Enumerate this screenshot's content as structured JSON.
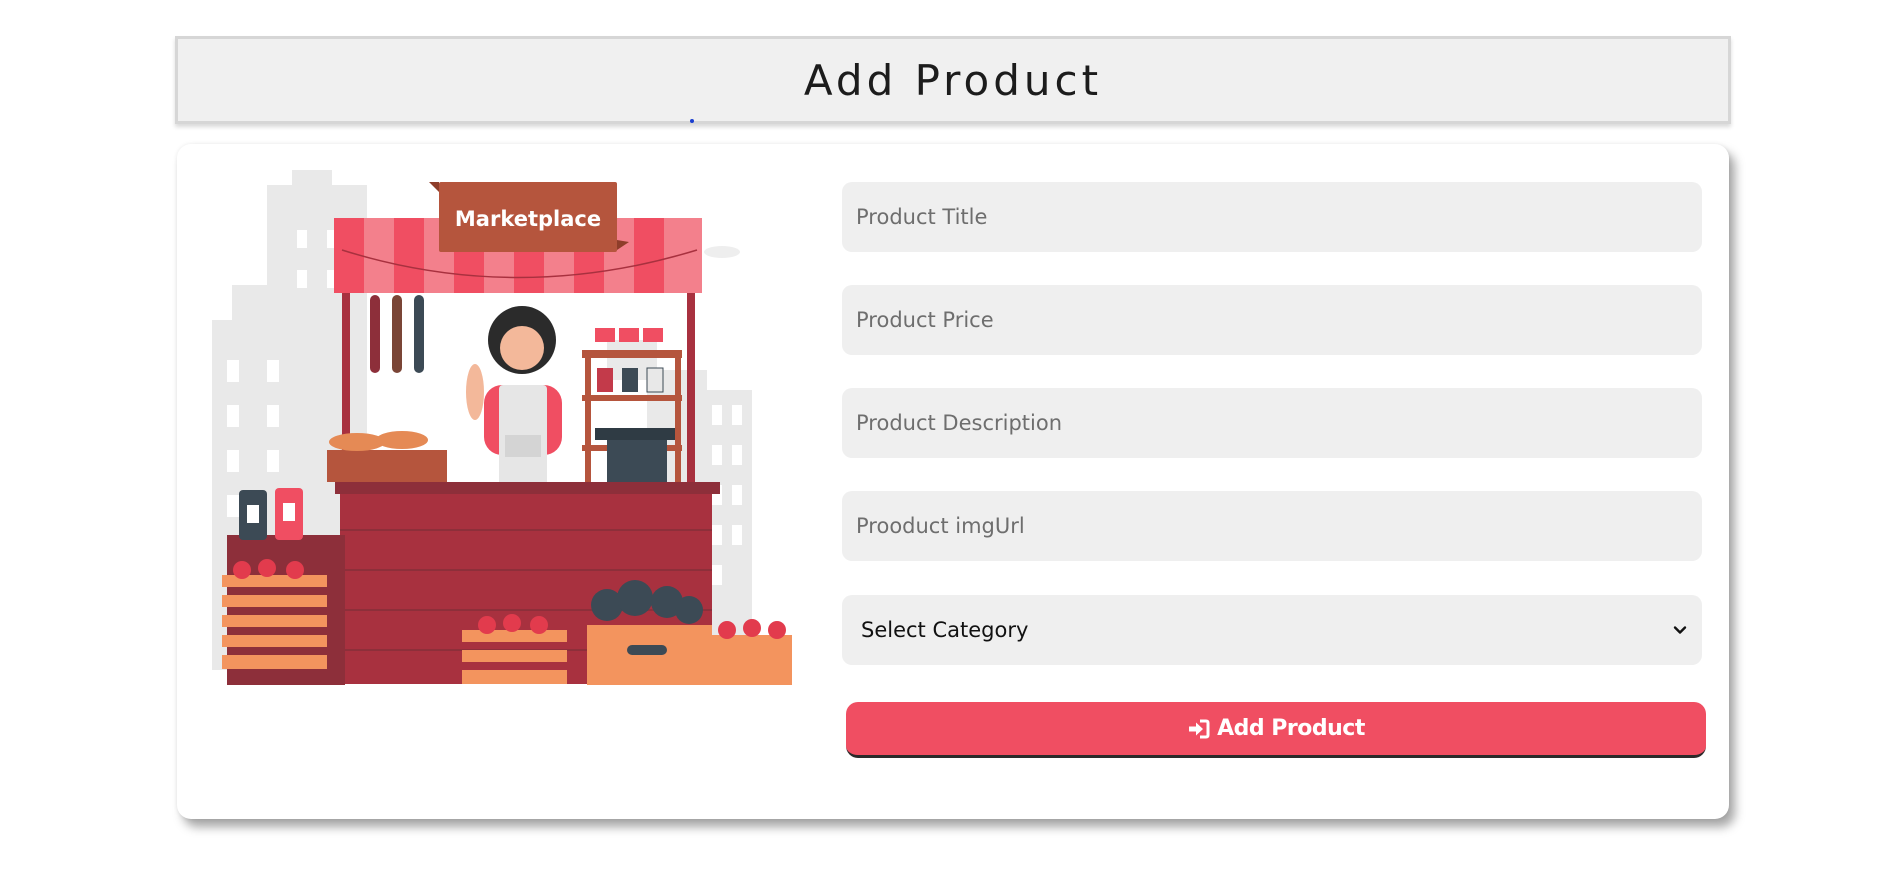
{
  "header": {
    "title": "Add Product"
  },
  "illustration": {
    "sign_text": "Marketplace"
  },
  "form": {
    "title_placeholder": "Product Title",
    "price_placeholder": "Product Price",
    "description_placeholder": "Product Description",
    "img_placeholder": "Prooduct imgUrl",
    "category_selected": "Select Category",
    "submit_label": "Add Product",
    "submit_icon": "sign-in-icon"
  },
  "colors": {
    "accent": "#f04e62",
    "field_bg": "#efefef",
    "header_bg": "#f0f0f0",
    "stall_red": "#a8313f"
  }
}
